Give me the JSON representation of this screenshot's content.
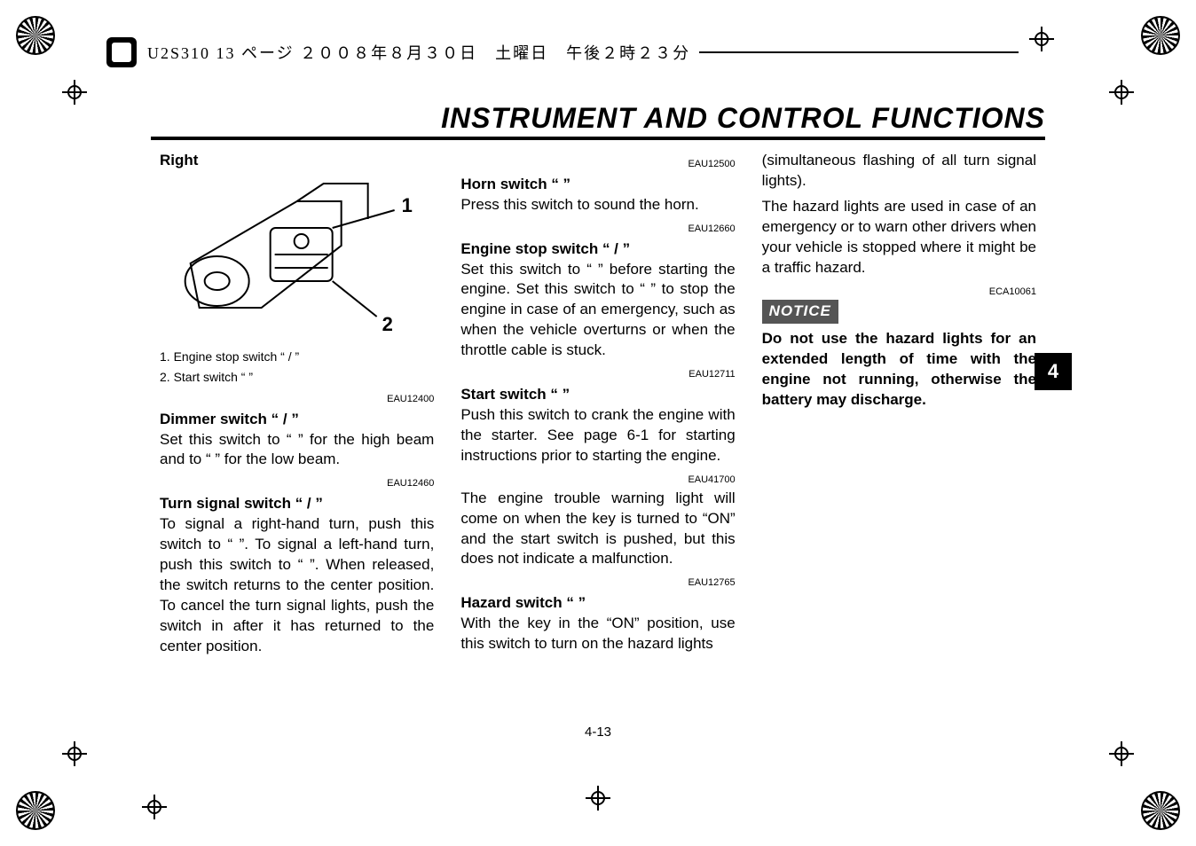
{
  "header": {
    "file_info": "U2S310  13 ページ  ２００８年８月３０日　土曜日　午後２時２３分"
  },
  "title": "INSTRUMENT AND CONTROL FUNCTIONS",
  "page_number": "4-13",
  "tab_number": "4",
  "col1": {
    "diagram_label": "Right",
    "callout_1": "1",
    "callout_2": "2",
    "legend1": "1. Engine stop switch “      /      ”",
    "legend2": "2. Start switch “     ”",
    "code_dimmer": "EAU12400",
    "dimmer_head": "Dimmer switch “        /        ”",
    "dimmer_body": "Set this switch to “     ” for the high beam and to “     ” for the low beam.",
    "code_turn": "EAU12460",
    "turn_head": "Turn signal switch “   /   ”",
    "turn_body": "To signal a right-hand turn, push this switch to “   ”. To signal a left-hand turn, push this switch to “   ”. When released, the switch returns to the center position. To cancel the turn signal lights, push the switch in after it has returned to the center position."
  },
  "col2": {
    "code_horn": "EAU12500",
    "horn_head": "Horn switch “      ”",
    "horn_body": "Press this switch to sound the horn.",
    "code_stop": "EAU12660",
    "stop_head": "Engine stop switch “      /      ”",
    "stop_body": "Set this switch to “    ” before starting the engine. Set this switch to “    ” to stop the engine in case of an emergency, such as when the vehicle overturns or when the throttle cable is stuck.",
    "code_start": "EAU12711",
    "start_head": "Start switch “     ”",
    "start_body": "Push this switch to crank the engine with the starter. See page 6-1 for starting instructions prior to starting the engine.",
    "code_warn": "EAU41700",
    "warn_body": "The engine trouble warning light will come on when the key is turned to “ON” and the start switch is pushed, but this does not indicate a malfunction.",
    "code_hazard": "EAU12765",
    "hazard_head": "Hazard switch “     ”",
    "hazard_body": "With the key in the “ON” position, use this switch to turn on the hazard lights"
  },
  "col3": {
    "continuation": "(simultaneous flashing of all turn signal lights).",
    "hazard_use": "The hazard lights are used in case of an emergency or to warn other drivers when your vehicle is stopped where it might be a traffic hazard.",
    "code_notice": "ECA10061",
    "notice_label": "NOTICE",
    "notice_body": "Do not use the hazard lights for an extended length of time with the engine not running, otherwise the battery may discharge."
  }
}
